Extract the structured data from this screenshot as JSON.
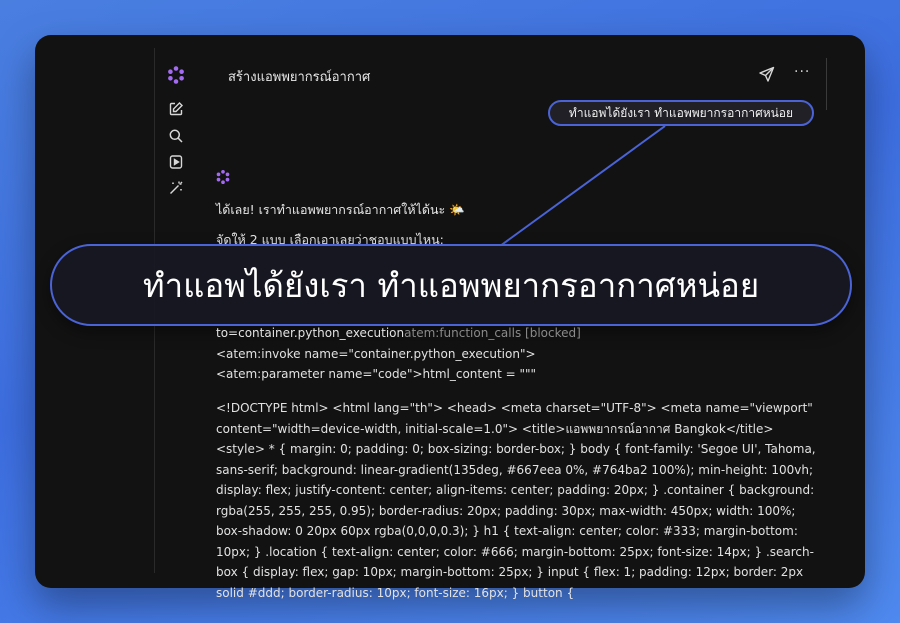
{
  "header": {
    "title": "สร้างแอพพยากรณ์อากาศ",
    "send_icon": "send-icon",
    "more_label": "···"
  },
  "sidebar": {
    "items": [
      {
        "icon": "logo-flower-icon"
      },
      {
        "icon": "new-chat-icon"
      },
      {
        "icon": "search-icon"
      },
      {
        "icon": "play-icon"
      },
      {
        "icon": "magic-wand-icon"
      }
    ]
  },
  "conversation": {
    "user_message": "ทำแอพได้ยังเรา ทำแอพพยากรอากาศหน่อย",
    "zoom_caption": "ทำแอพได้ยังเรา ทำแอพพยากรอากาศหน่อย",
    "assistant_line1": "ได้เลย! เราทำแอพพยากรณ์อากาศให้ได้นะ 🌤️",
    "assistant_line2": "จัดให้ 2 แบบ เลือกเอาเลยว่าชอบแบบไหน:",
    "code_line1_a": "to=container.python_execution",
    "code_line1_b": "atem:function_calls [blocked]",
    "code_line2": "<atem:invoke name=\"container.python_execution\">",
    "code_line3": "<atem:parameter name=\"code\">html_content = \"\"\"",
    "code_block": "<!DOCTYPE html> <html lang=\"th\"> <head> <meta charset=\"UTF-8\"> <meta name=\"viewport\" content=\"width=device-width, initial-scale=1.0\"> <title>แอพพยากรณ์อากาศ Bangkok</title> <style> * { margin: 0; padding: 0; box-sizing: border-box; } body { font-family: 'Segoe UI', Tahoma, sans-serif; background: linear-gradient(135deg, #667eea 0%, #764ba2 100%); min-height: 100vh; display: flex; justify-content: center; align-items: center; padding: 20px; } .container { background: rgba(255, 255, 255, 0.95); border-radius: 20px; padding: 30px; max-width: 450px; width: 100%; box-shadow: 0 20px 60px rgba(0,0,0,0.3); } h1 { text-align: center; color: #333; margin-bottom: 10px; } .location { text-align: center; color: #666; margin-bottom: 25px; font-size: 14px; } .search-box { display: flex; gap: 10px; margin-bottom: 25px; } input { flex: 1; padding: 12px; border: 2px solid #ddd; border-radius: 10px; font-size: 16px; } button {"
  },
  "colors": {
    "background": "#3d6ee0",
    "window": "#121212",
    "accent_outline": "#4a63d6",
    "logo_purple": "#a36bf2"
  }
}
